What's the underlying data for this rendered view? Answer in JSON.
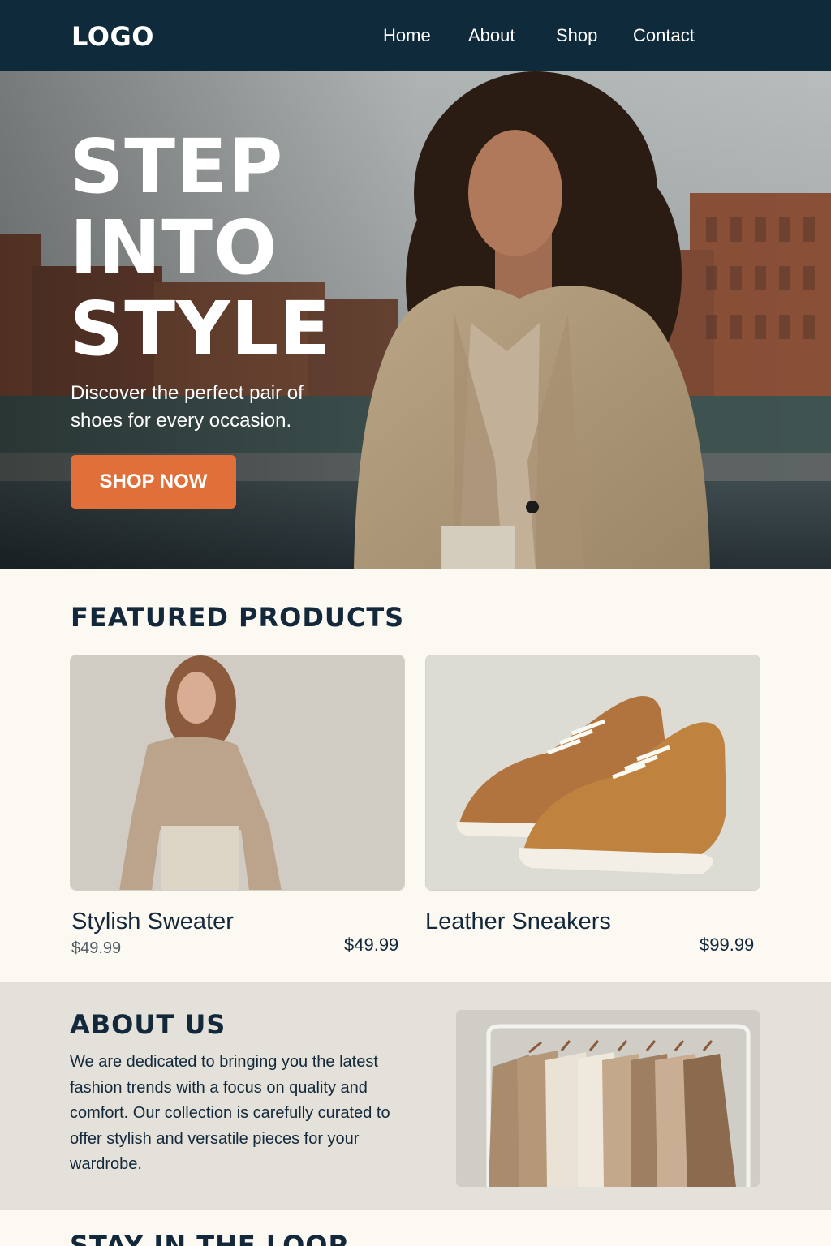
{
  "nav": {
    "logo": "LOGO",
    "links": [
      "Home",
      "About",
      "Shop",
      "Contact"
    ]
  },
  "hero": {
    "title_lines": [
      "STEP",
      "INTO",
      "STYLE"
    ],
    "subtitle": "Discover the perfect pair of shoes for every occasion.",
    "cta": "SHOP NOW"
  },
  "featured": {
    "title": "FEATURED PRODUCTS",
    "products": [
      {
        "name": "Stylish Sweater",
        "sub_price": "$49.99",
        "price": "$49.99"
      },
      {
        "name": "Leather Sneakers",
        "price": "$99.99"
      }
    ]
  },
  "about": {
    "title": "ABOUT US",
    "text": "We are dedicated to bringing you the latest fashion trends with a focus on quality and comfort. Our collection is carefully curated to offer stylish and versatile pieces for your wardrobe."
  },
  "stay": {
    "title": "STAY IN THE LOOP"
  },
  "colors": {
    "nav_bg": "#0f2a3a",
    "accent": "#e06f3a",
    "page_bg": "#fbf9f2",
    "about_bg": "#e3e1da"
  }
}
